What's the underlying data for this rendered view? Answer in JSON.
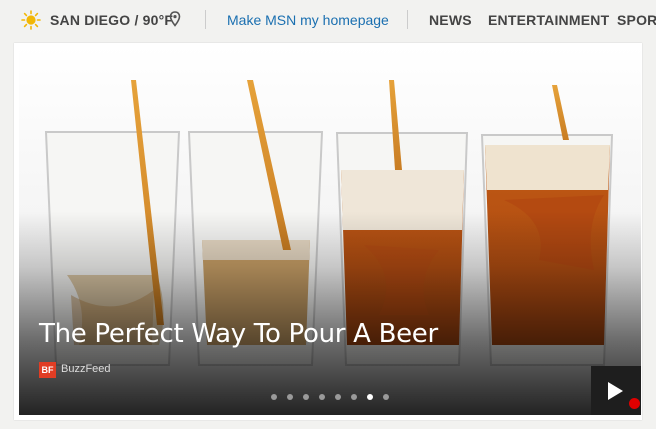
{
  "header": {
    "weather": {
      "location_temp": "SAN DIEGO / 90°F",
      "icon": "sun-icon"
    },
    "homepage_link": "Make MSN my homepage",
    "nav_items": [
      "NEWS",
      "ENTERTAINMENT",
      "SPORT"
    ]
  },
  "hero": {
    "headline": "The Perfect Way To Pour A Beer",
    "source_badge": "BF",
    "source_name": "BuzzFeed",
    "slide_count": 8,
    "active_slide": 7,
    "play_icon": "play-icon"
  },
  "colors": {
    "link": "#1a6fb0",
    "badge": "#e03d24",
    "sun": "#f2b705"
  }
}
